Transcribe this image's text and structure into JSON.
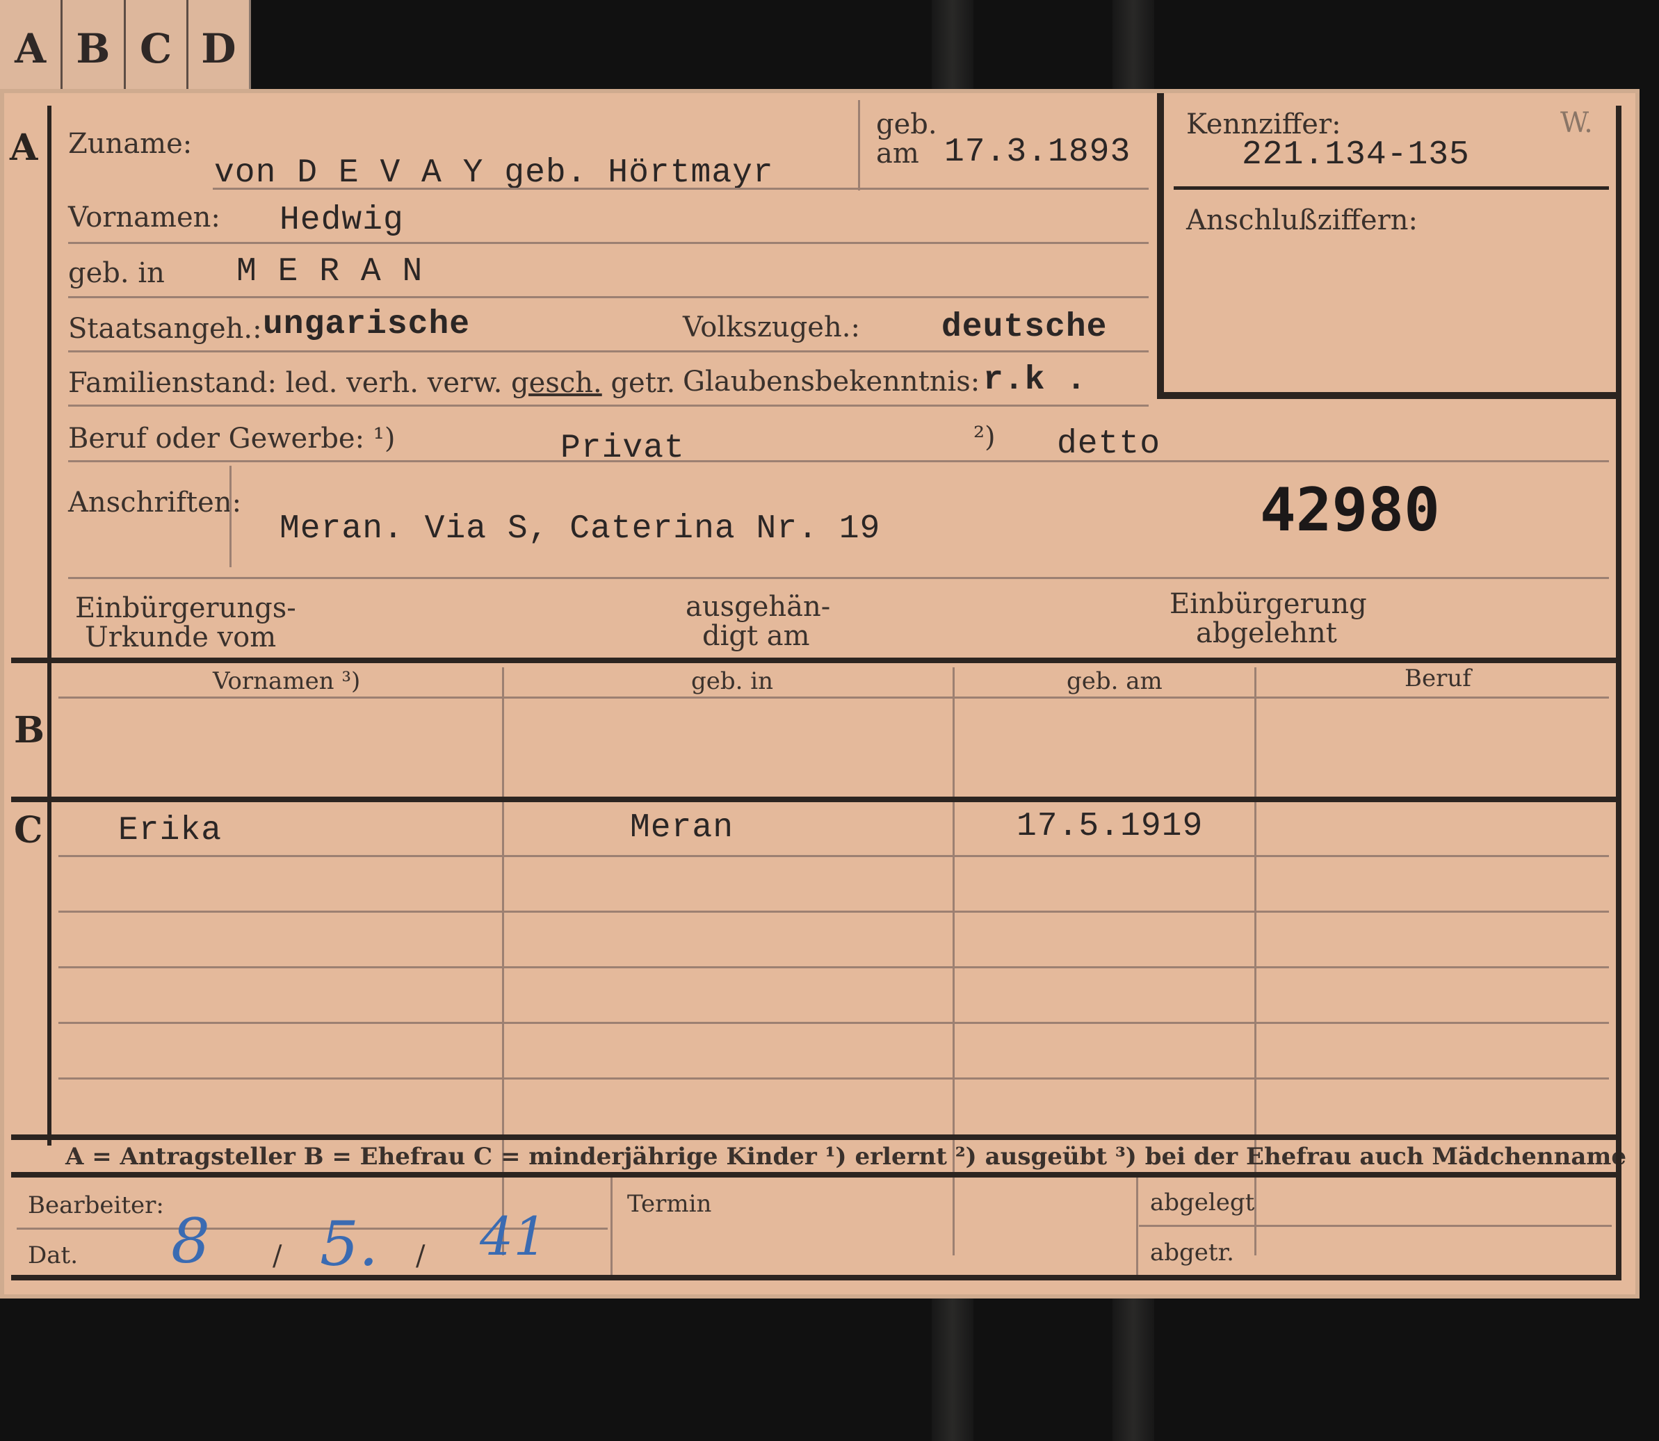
{
  "tabs": [
    "A",
    "B",
    "C",
    "D"
  ],
  "section_a": {
    "letter": "A",
    "zuname_label": "Zuname:",
    "zuname_value": "von D E V A Y  geb. Hörtmayr",
    "geb_label": "geb.",
    "am_label": "am",
    "geb_am_value": "17.3.1893",
    "vornamen_label": "Vornamen:",
    "vornamen_value": "Hedwig",
    "geb_in_label": "geb. in",
    "geb_in_value": "M E R A N",
    "staatsangeh_label": "Staatsangeh.:",
    "staatsangeh_value": "ungarische",
    "volkszugeh_label": "Volkszugeh.:",
    "volkszugeh_value": "deutsche",
    "familienstand_label": "Familienstand: led. verh. verw.",
    "familienstand_selected": "gesch.",
    "familienstand_rest": "getr.",
    "glaubensbekenntnis_label": "Glaubensbekenntnis:",
    "glaubensbekenntnis_value": "r.k .",
    "beruf_label": "Beruf oder Gewerbe: ¹)",
    "beruf_value": "Privat",
    "beruf2_label": "²)",
    "beruf2_value": "detto",
    "anschriften_label": "Anschriften:",
    "anschriften_value": "Meran. Via S, Caterina   Nr. 19",
    "big_number": "42980",
    "einbuergerung_label_1": "Einbürgerungs-",
    "einbuergerung_label_2": "Urkunde vom",
    "ausgehaendigt_label_1": "ausgehän-",
    "ausgehaendigt_label_2": "digt am",
    "abgelehnt_label_1": "Einbürgerung",
    "abgelehnt_label_2": "abgelehnt"
  },
  "right_box": {
    "kennziffer_label": "Kennziffer:",
    "kennziffer_value": "221.134-135",
    "w_mark": "W.",
    "anschluss_label": "Anschlußziffern:"
  },
  "section_b": {
    "letter": "B",
    "headers": [
      "Vornamen ³)",
      "geb. in",
      "geb. am",
      "Beruf"
    ]
  },
  "section_c": {
    "letter": "C",
    "rows": [
      [
        "Erika",
        "Meran",
        "17.5.1919",
        ""
      ]
    ]
  },
  "legend": "A = Antragsteller   B = Ehefrau   C = minderjährige Kinder   ¹) erlernt   ²) ausgeübt   ³) bei der Ehefrau auch Mädchenname",
  "footer": {
    "bearbeiter_label": "Bearbeiter:",
    "dat_label": "Dat.",
    "date_day": "8",
    "date_month": "5.",
    "date_year": "41",
    "date_sep": "/",
    "termin_label": "Termin",
    "abgelegt_label": "abgelegt",
    "abgetr_label": "abgetr."
  }
}
